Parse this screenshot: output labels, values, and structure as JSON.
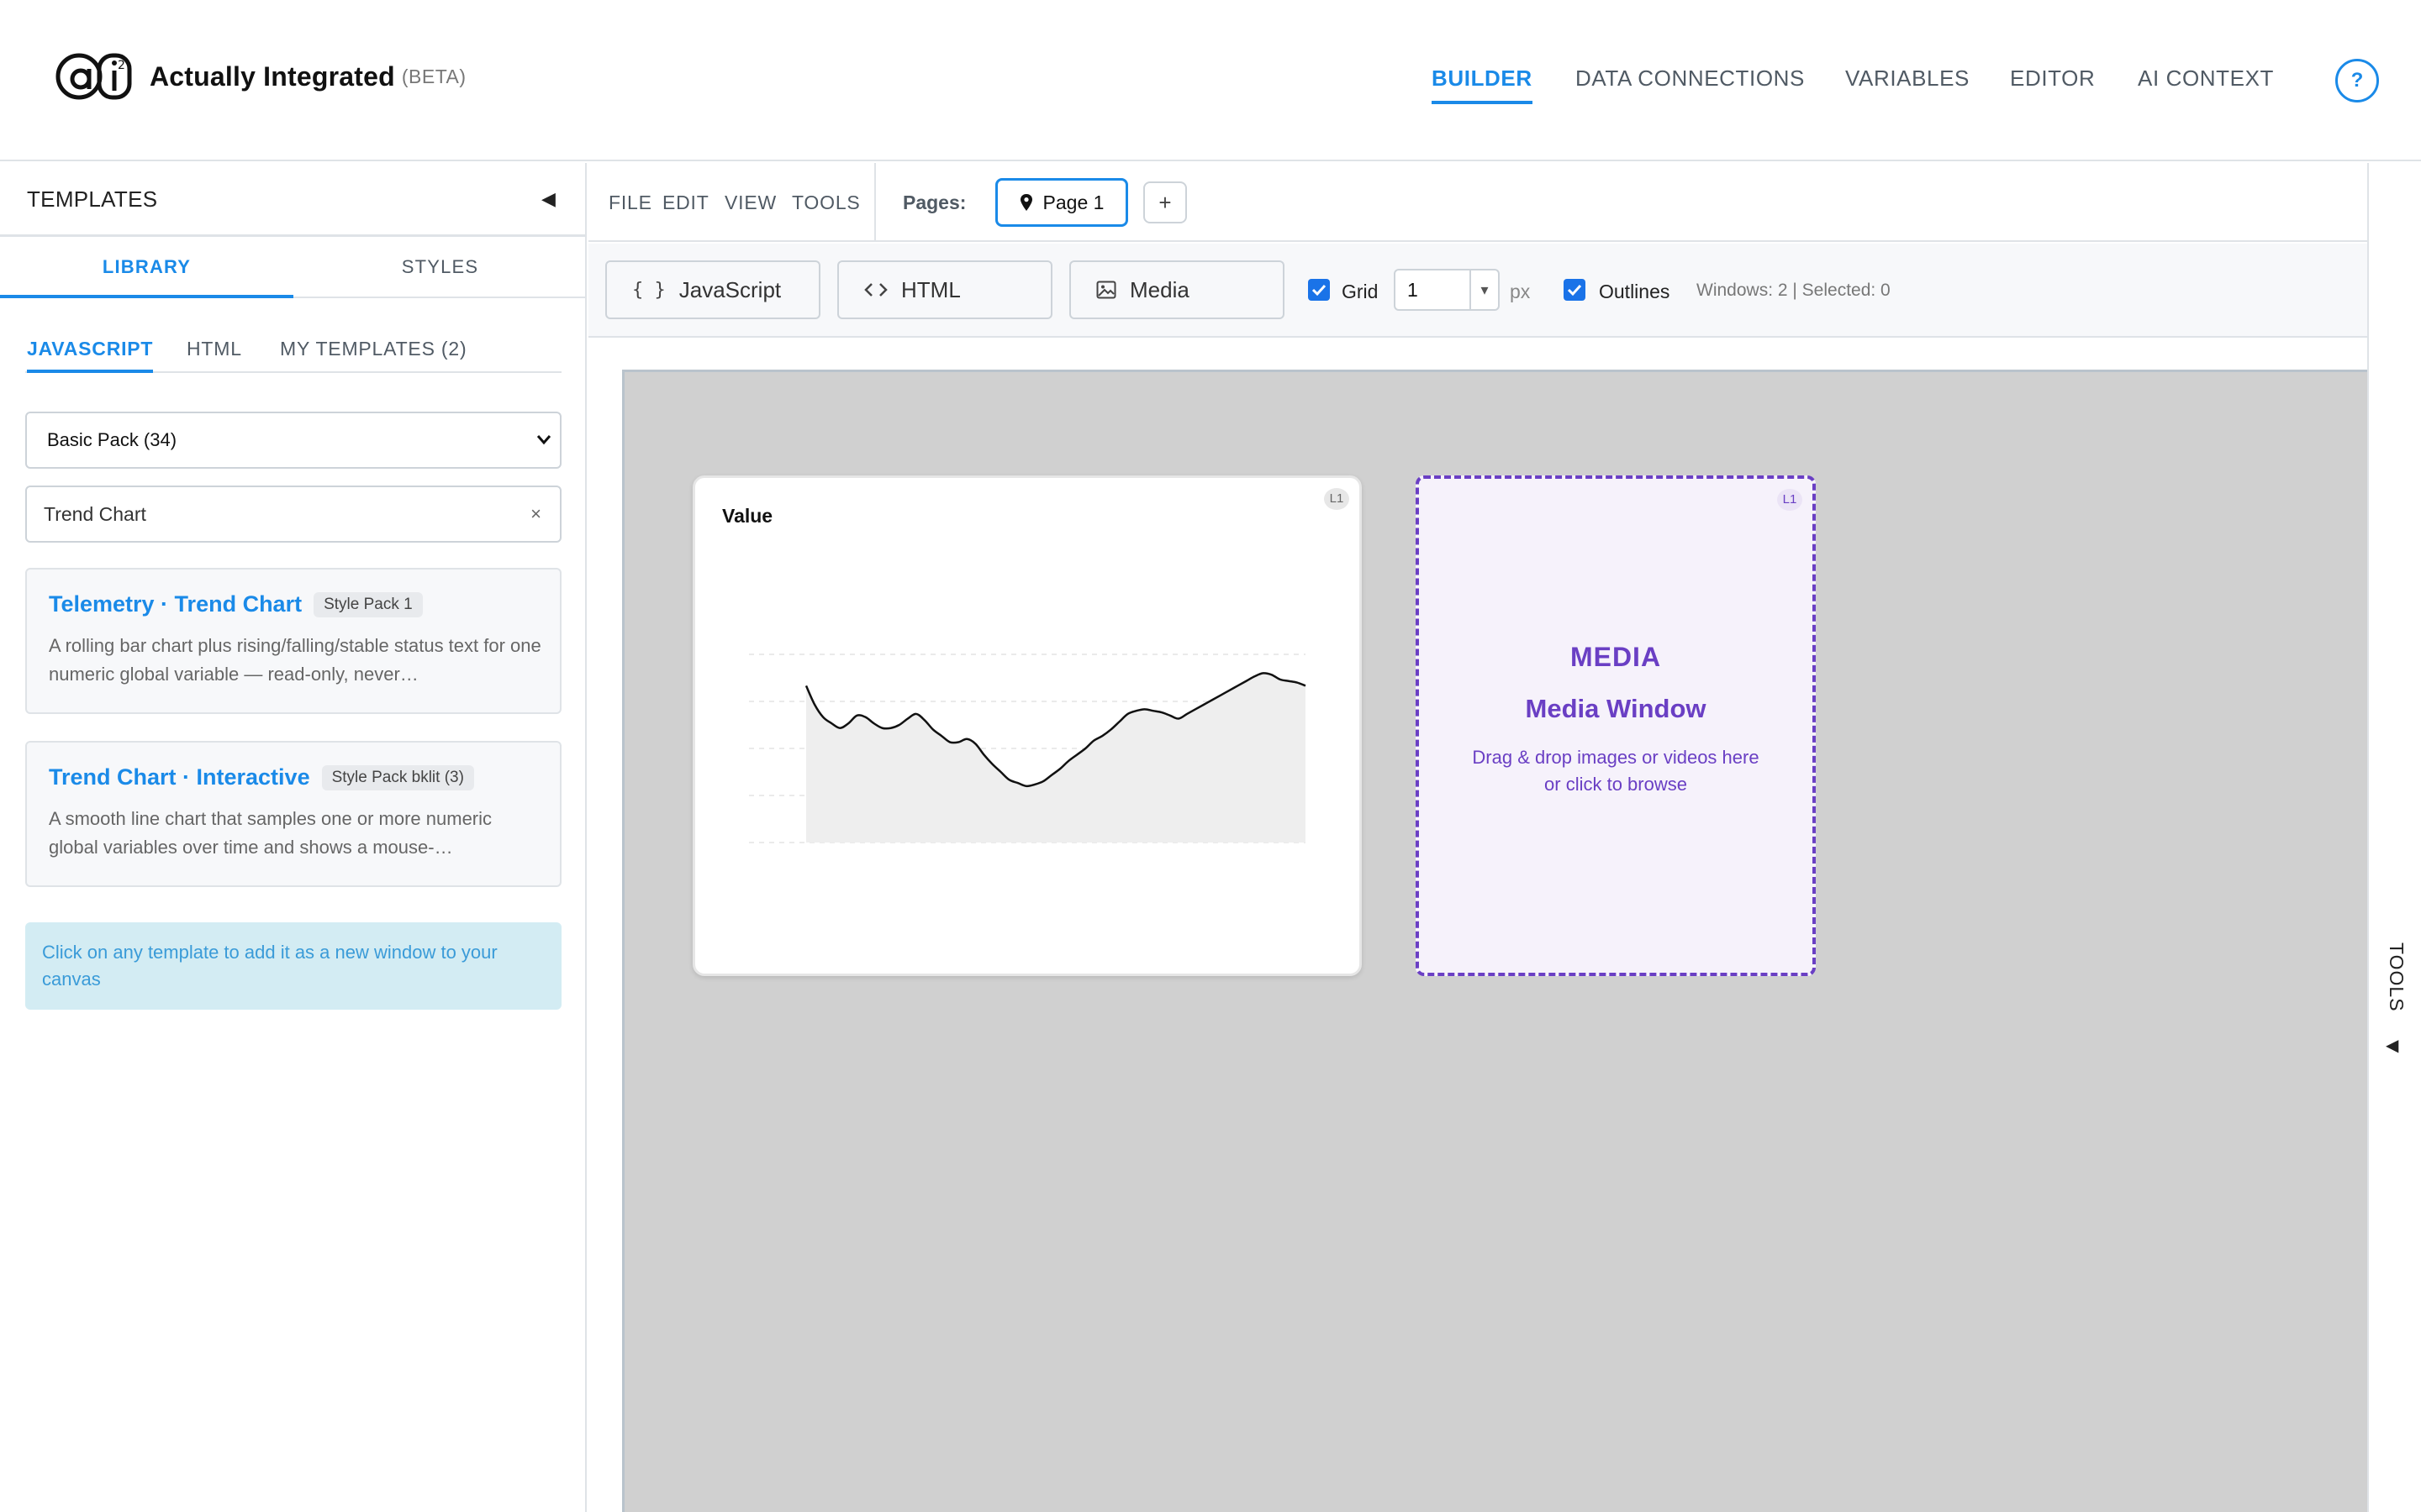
{
  "app": {
    "brand_name": "Actually Integrated",
    "brand_tag": "(BETA)",
    "logo_text": "ai2"
  },
  "nav": {
    "items": [
      "BUILDER",
      "DATA CONNECTIONS",
      "VARIABLES",
      "EDITOR",
      "AI CONTEXT"
    ],
    "active": "BUILDER",
    "help_label": "?"
  },
  "sidebar": {
    "title": "TEMPLATES",
    "collapse_icon": "◀",
    "tabs": [
      "LIBRARY",
      "STYLES"
    ],
    "sub_tabs": [
      "JAVASCRIPT",
      "HTML",
      "MY TEMPLATES (2)"
    ],
    "pack_select": "Basic Pack (34)",
    "search_value": "Trend Chart",
    "search_clear": "×",
    "templates": [
      {
        "title": "Telemetry · Trend Chart",
        "badge": "Style Pack 1",
        "description": "A rolling bar chart plus rising/falling/stable status text for one numeric global variable — read-only, never…"
      },
      {
        "title": "Trend Chart · Interactive",
        "badge": "Style Pack bklit (3)",
        "description": "A smooth line chart that samples one or more numeric global variables over time and shows a mouse-…"
      }
    ],
    "info": "Click on any template to add it as a new window to your canvas"
  },
  "menubar": {
    "items": [
      "FILE",
      "EDIT",
      "VIEW",
      "TOOLS"
    ],
    "pages_label": "Pages:",
    "page_tab": "Page 1",
    "add_page": "+"
  },
  "toolbar": {
    "add_javascript": "JavaScript",
    "add_html": "HTML",
    "add_media": "Media",
    "grid_label": "Grid",
    "grid_value": "1",
    "grid_unit": "px",
    "outlines_label": "Outlines",
    "status": "Windows: 2 | Selected: 0",
    "grid_checked": true,
    "outlines_checked": true
  },
  "canvas": {
    "chart_window": {
      "title": "Value",
      "layer_badge": "L1"
    },
    "media_window": {
      "layer_badge": "L1",
      "heading": "MEDIA",
      "title": "Media Window",
      "hint_line1": "Drag & drop images or videos here",
      "hint_line2": "or click to browse"
    }
  },
  "tools_rail": {
    "label": "TOOLS",
    "arrow": "◀"
  },
  "colors": {
    "accent": "#1a8ae8",
    "media": "#6a3fc4",
    "canvas_bg": "#d0d0d0"
  },
  "chart_data": {
    "type": "area",
    "title": "Value",
    "x": [
      0,
      1,
      2,
      3,
      4,
      5,
      6,
      7,
      8,
      9,
      10,
      11,
      12,
      13,
      14,
      15,
      16,
      17,
      18,
      19,
      20,
      21,
      22,
      23,
      24,
      25,
      26,
      27,
      28,
      29,
      30,
      31,
      32,
      33,
      34,
      35,
      36,
      37,
      38,
      39,
      40,
      41,
      42,
      43,
      44,
      45,
      46,
      47,
      48,
      49,
      50,
      51,
      52,
      53,
      54,
      55,
      56,
      57,
      58,
      59
    ],
    "values": [
      100,
      88,
      80,
      76,
      73,
      76,
      81,
      80,
      76,
      73,
      73,
      75,
      79,
      82,
      78,
      72,
      68,
      64,
      64,
      66,
      63,
      56,
      50,
      45,
      40,
      38,
      36,
      37,
      39,
      43,
      47,
      52,
      56,
      60,
      65,
      68,
      72,
      77,
      82,
      84,
      85,
      84,
      83,
      81,
      79,
      82,
      85,
      88,
      91,
      94,
      97,
      100,
      103,
      106,
      108,
      107,
      104,
      103,
      102,
      100
    ],
    "ylim": [
      0,
      120
    ],
    "grid": true
  }
}
